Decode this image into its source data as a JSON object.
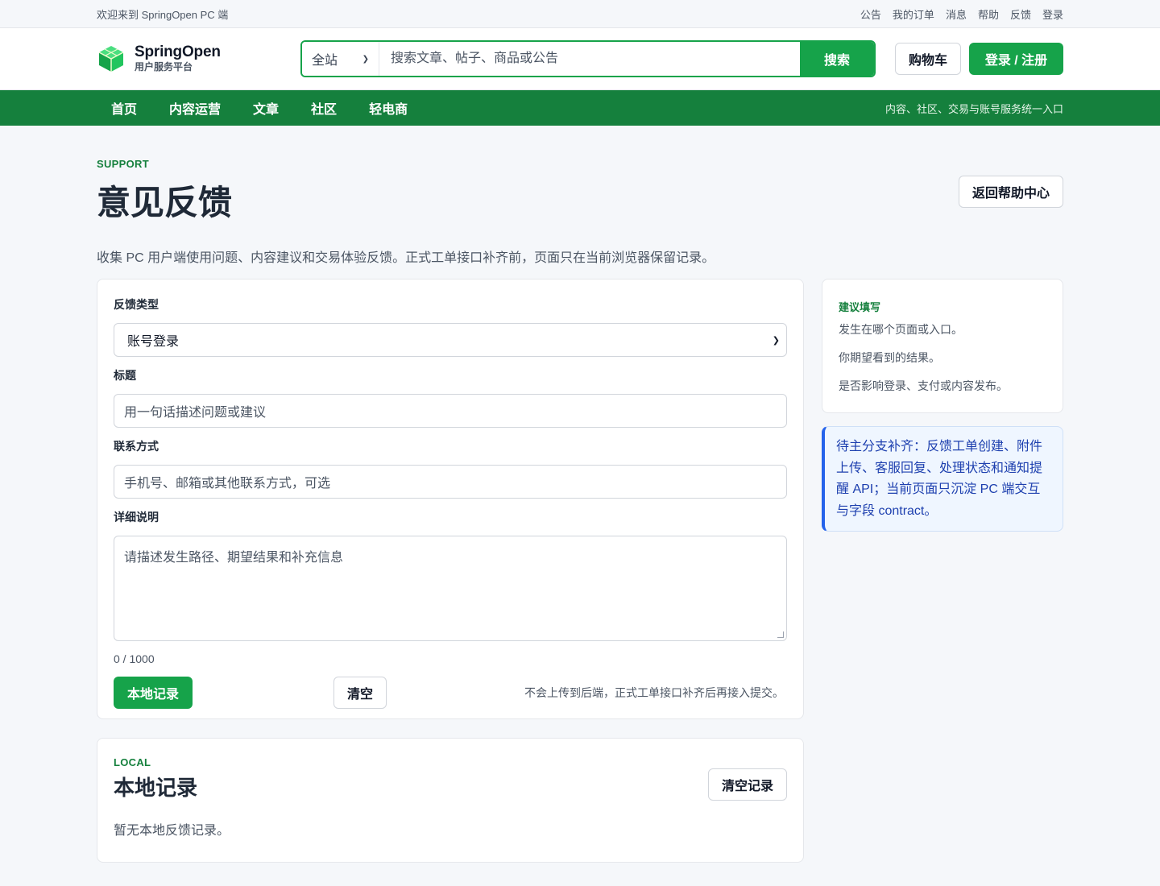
{
  "topbar": {
    "welcome": "欢迎来到 SpringOpen PC 端",
    "links": [
      "公告",
      "我的订单",
      "消息",
      "帮助",
      "反馈",
      "登录"
    ]
  },
  "header": {
    "brand_name": "SpringOpen",
    "brand_sub": "用户服务平台",
    "search_scope": "全站",
    "search_placeholder": "搜索文章、帖子、商品或公告",
    "search_button": "搜索",
    "cart_button": "购物车",
    "login_button": "登录 / 注册",
    "logo_icon": "cube-icon"
  },
  "nav": {
    "items": [
      "首页",
      "内容运营",
      "文章",
      "社区",
      "轻电商"
    ],
    "tagline": "内容、社区、交易与账号服务统一入口"
  },
  "page": {
    "eyebrow": "SUPPORT",
    "title": "意见反馈",
    "back_button": "返回帮助中心",
    "intro": "收集 PC 用户端使用问题、内容建议和交易体验反馈。正式工单接口补齐前，页面只在当前浏览器保留记录。"
  },
  "form": {
    "type_label": "反馈类型",
    "type_value": "账号登录",
    "title_label": "标题",
    "title_placeholder": "用一句话描述问题或建议",
    "contact_label": "联系方式",
    "contact_placeholder": "手机号、邮箱或其他联系方式，可选",
    "detail_label": "详细说明",
    "detail_placeholder": "请描述发生路径、期望结果和补充信息",
    "counter": "0 / 1000",
    "save_button": "本地记录",
    "clear_button": "清空",
    "note": "不会上传到后端，正式工单接口补齐后再接入提交。"
  },
  "tips": {
    "title": "建议填写",
    "items": [
      "发生在哪个页面或入口。",
      "你期望看到的结果。",
      "是否影响登录、支付或内容发布。"
    ]
  },
  "pending_notice": "待主分支补齐：反馈工单创建、附件上传、客服回复、处理状态和通知提醒 API；当前页面只沉淀 PC 端交互与字段 contract。",
  "local": {
    "eyebrow": "LOCAL",
    "title": "本地记录",
    "clear_button": "清空记录",
    "empty_text": "暂无本地反馈记录。"
  },
  "colors": {
    "brand_green": "#16a34a",
    "nav_green": "#15803d",
    "notice_blue": "#2563eb",
    "page_bg": "#f5f7fa"
  }
}
